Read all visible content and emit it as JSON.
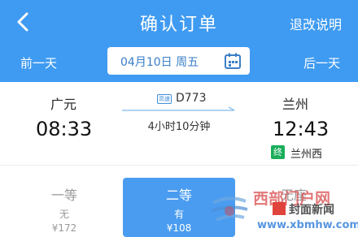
{
  "header": {
    "title": "确认订单",
    "help_label": "退改说明"
  },
  "datebar": {
    "prev_label": "前一天",
    "date_text": "04月10日 周五",
    "next_label": "后一天"
  },
  "train": {
    "badge_text": "高速",
    "number": "D773",
    "duration": "4小时10分钟",
    "departure": {
      "station": "广元",
      "time": "08:33"
    },
    "arrival": {
      "station": "兰州",
      "time": "12:43",
      "terminal_badge": "终",
      "terminal_station": "兰州西"
    }
  },
  "seats": [
    {
      "name": "一等",
      "availability": "无",
      "price": "¥172"
    },
    {
      "name": "二等",
      "availability": "有",
      "price": "¥108"
    },
    {
      "name": "无座",
      "availability": "",
      "price": ""
    }
  ],
  "watermark": {
    "line1": "西部门户网",
    "line2": "封面新闻",
    "line3": "www.xbmhw.com"
  },
  "colors": {
    "primary": "#3f9bf1",
    "selected_seat": "#4a9cf0",
    "terminal_badge": "#1aad5a"
  }
}
